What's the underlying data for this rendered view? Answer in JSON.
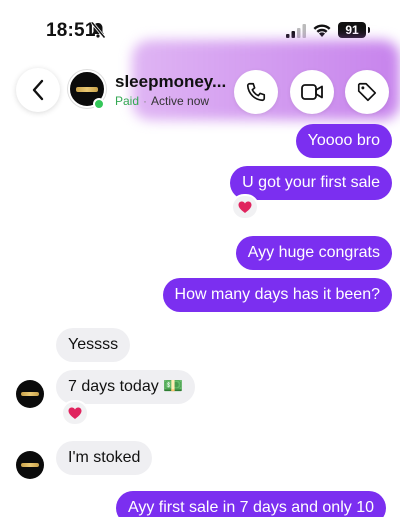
{
  "status_bar": {
    "time": "18:51",
    "battery": "91",
    "icons": [
      "silent-mode-icon",
      "cellular-signal-icon",
      "wifi-icon",
      "battery-icon"
    ]
  },
  "header": {
    "name": "sleepmoney...",
    "paid": "Paid",
    "separator": "·",
    "status": "Active now",
    "icons": [
      "back-chevron-icon",
      "phone-icon",
      "video-camera-icon",
      "tag-icon"
    ]
  },
  "messages": [
    {
      "from": "me",
      "text": "Yoooo bro"
    },
    {
      "from": "me",
      "text": "U got your first sale",
      "reaction": "❤️"
    },
    {
      "from": "me",
      "text": "Ayy huge congrats"
    },
    {
      "from": "me",
      "text": "How many days has it been?"
    },
    {
      "from": "them",
      "text": "Yessss"
    },
    {
      "from": "them",
      "text": "7 days today 💵",
      "reaction": "❤️"
    },
    {
      "from": "them",
      "text": "I'm stoked"
    },
    {
      "from": "me",
      "text": "Ayy first sale in 7 days and only 10"
    }
  ],
  "colors": {
    "accent": "#7b2ff0",
    "incoming_bubble": "#efeff2",
    "online": "#34c759",
    "paid_label": "#34a853",
    "header_glow": "#b45ae6"
  }
}
